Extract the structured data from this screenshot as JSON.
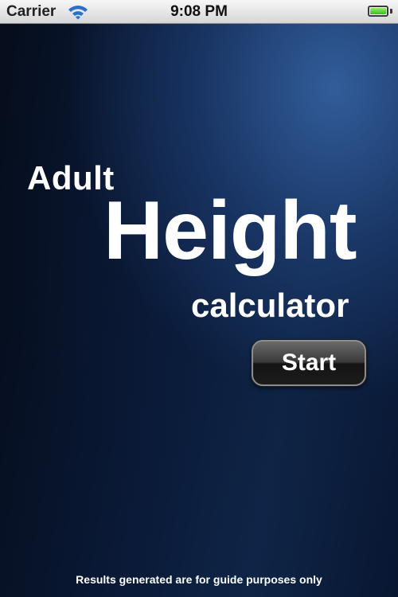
{
  "status_bar": {
    "carrier": "Carrier",
    "time": "9:08 PM",
    "battery_level": 1.0,
    "icons": [
      "wifi-icon",
      "battery-icon"
    ]
  },
  "title": {
    "line1": "Adult",
    "line2": "Height",
    "line3": "calculator"
  },
  "start_button": {
    "label": "Start"
  },
  "footer": {
    "disclaimer": "Results generated are for guide purposes only"
  },
  "colors": {
    "background": "#07132a",
    "text": "#ffffff",
    "battery": "#4cd12a"
  }
}
